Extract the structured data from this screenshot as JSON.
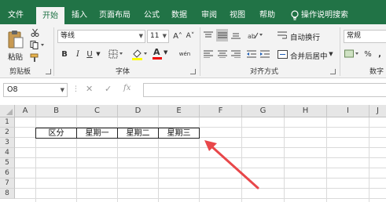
{
  "tabs": [
    "文件",
    "开始",
    "插入",
    "页面布局",
    "公式",
    "数据",
    "审阅",
    "视图",
    "帮助"
  ],
  "active_tab": "开始",
  "tell_me": "操作说明搜索",
  "ribbon": {
    "paste_label": "粘贴",
    "clipboard_label": "剪贴板",
    "font_name": "等线",
    "font_size": "11",
    "grow_font": "A˄",
    "shrink_font": "A˅",
    "bold": "B",
    "italic": "I",
    "underline": "U",
    "font_color_glyph": "A",
    "phonetic_glyph": "wén",
    "font_label": "字体",
    "wrap_text": "自动换行",
    "merge_center": "合并后居中",
    "alignment_label": "对齐方式",
    "number_format": "常规",
    "percent": "%",
    "comma": ",",
    "number_label": "数字"
  },
  "formula_bar": {
    "name_box": "O8",
    "cancel": "✕",
    "enter": "✓",
    "fx": "fx",
    "value": ""
  },
  "sheet": {
    "columns": [
      "A",
      "B",
      "C",
      "D",
      "E",
      "F",
      "G",
      "H",
      "I",
      "J"
    ],
    "rows": [
      "1",
      "2",
      "3",
      "4",
      "5",
      "6",
      "7",
      "8"
    ],
    "cells": [
      "区分",
      "星期一",
      "星期二",
      "星期三"
    ]
  },
  "colors": {
    "accent": "#217346",
    "annotation_arrow": "#e8474a"
  }
}
